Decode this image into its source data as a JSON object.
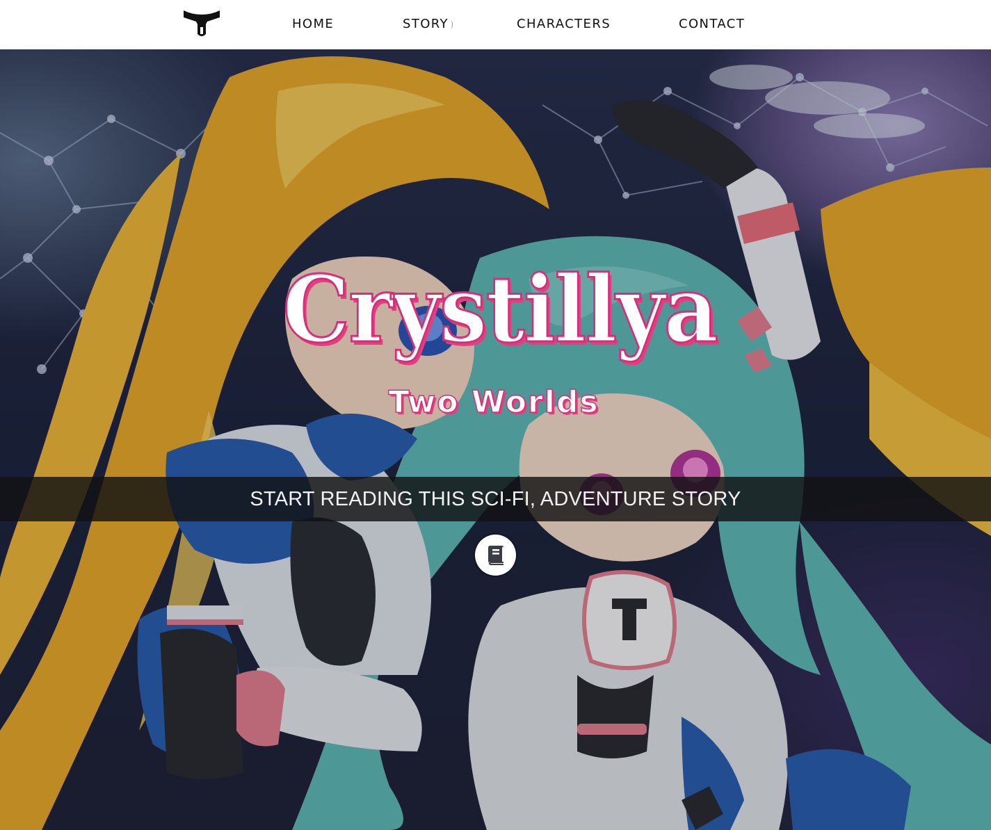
{
  "header": {
    "logo_icon": "yoke-logo-icon",
    "nav": [
      {
        "label": "HOME"
      },
      {
        "label": "STORY"
      },
      {
        "label": "CHARACTERS"
      },
      {
        "label": "CONTACT"
      }
    ]
  },
  "hero": {
    "title": "Crystillya",
    "subtitle": "Two Worlds",
    "cta": "START READING THIS SCI-FI, ADVENTURE STORY",
    "read_button_icon": "book-icon",
    "colors": {
      "title_outline": "#d62e7a",
      "cta_band": "#121214"
    }
  }
}
